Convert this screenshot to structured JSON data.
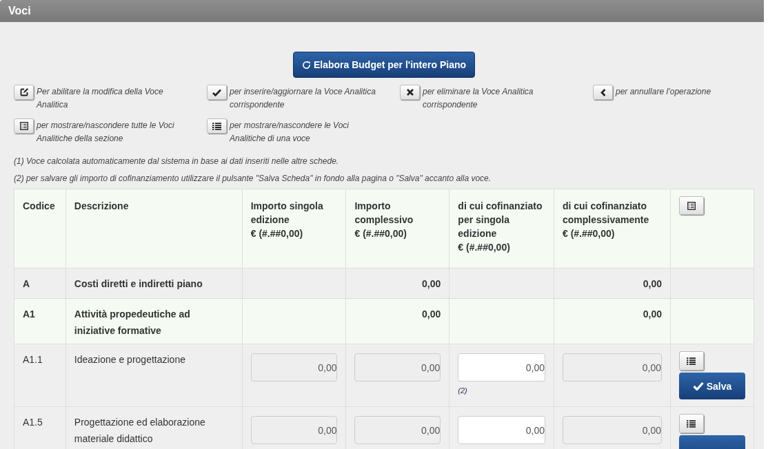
{
  "panel": {
    "title": "Voci"
  },
  "main_button": {
    "label": "Elabora Budget per l'intero Piano"
  },
  "legend": [
    {
      "kind": "edit",
      "text": "Per abilitare la modifica della Voce Analitica"
    },
    {
      "kind": "confirm",
      "text": "per inserire/aggiornare la Voce Analitica corrispondente"
    },
    {
      "kind": "delete",
      "text": "per eliminare la Voce Analitica corrispondente"
    },
    {
      "kind": "cancel",
      "text": "per annullare l’operazione"
    },
    {
      "kind": "toggle_all",
      "text": "per mostrare/nascondere tutte le Voci Analitiche della sezione"
    },
    {
      "kind": "toggle",
      "text": "per mostrare/nascondere le Voci Analitiche di una voce"
    }
  ],
  "notes": [
    "(1) Voce calcolata automaticamente dal sistema in base ai dati inseriti nelle altre schede.",
    "(2) per salvare gli importo di cofinanziamento utilizzare il pulsante \"Salva Scheda\" in fondo alla pagina o \"Salva\" accanto alla voce."
  ],
  "table": {
    "columns": [
      {
        "lines": [
          "Codice"
        ]
      },
      {
        "lines": [
          "Descrizione"
        ]
      },
      {
        "lines": [
          "Importo singola edizione",
          "€ (#.##0,00)"
        ]
      },
      {
        "lines": [
          "Importo complessivo",
          "€ (#.##0,00)"
        ]
      },
      {
        "lines": [
          "di cui cofinanziato per singola edizione",
          "€ (#.##0,00)"
        ]
      },
      {
        "lines": [
          "di cui cofinanziato complessivamente",
          "€ (#.##0,00)"
        ]
      }
    ],
    "rows": [
      {
        "kind": "group",
        "code": "A",
        "description": "Costi diretti e indiretti piano",
        "total_amount": "0,00",
        "total_cofinanced": "0,00"
      },
      {
        "kind": "subgroup",
        "code": "A1",
        "description": "Attività propedeutiche ad iniziative formative",
        "total_amount": "0,00",
        "total_cofinanced": "0,00"
      },
      {
        "kind": "item",
        "code": "A1.1",
        "description": "Ideazione e progettazione",
        "fields": [
          {
            "value": "0,00",
            "editable": false
          },
          {
            "value": "0,00",
            "editable": false
          },
          {
            "value": "0,00",
            "editable": true,
            "note": "(2)"
          },
          {
            "value": "0,00",
            "editable": false
          }
        ],
        "save_label": "Salva"
      },
      {
        "kind": "item",
        "code": "A1.5",
        "description": "Progettazione ed elaborazione materiale didattico",
        "fields": [
          {
            "value": "0,00",
            "editable": false
          },
          {
            "value": "0,00",
            "editable": false
          },
          {
            "value": "0,00",
            "editable": true
          },
          {
            "value": "0,00",
            "editable": false
          }
        ]
      }
    ]
  }
}
